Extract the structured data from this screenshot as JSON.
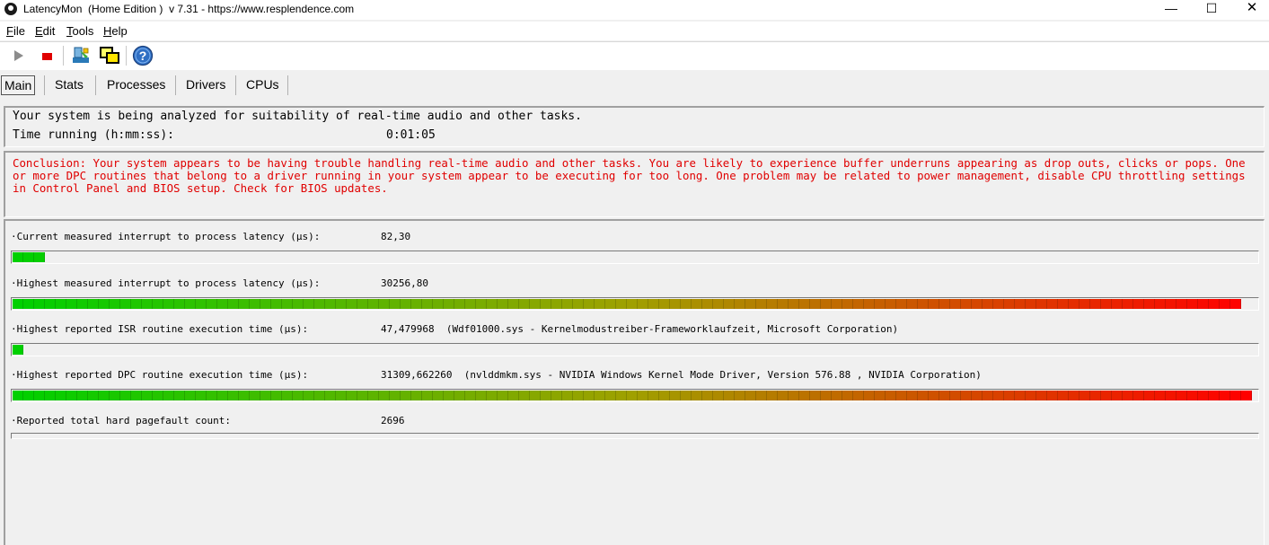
{
  "window": {
    "title": "LatencyMon  (Home Edition )  v 7.31 - https://www.resplendence.com",
    "minimize": "—",
    "maximize": "☐",
    "close": "✕"
  },
  "menu": [
    "File",
    "Edit",
    "Tools",
    "Help"
  ],
  "toolbar": {
    "icons": [
      "play-icon",
      "stop-icon",
      "process-tool-icon",
      "windows-tool-icon",
      "help-icon"
    ]
  },
  "tabs": [
    {
      "label": "Main",
      "active": true
    },
    {
      "label": "Stats",
      "active": false
    },
    {
      "label": "Processes",
      "active": false
    },
    {
      "label": "Drivers",
      "active": false
    },
    {
      "label": "CPUs",
      "active": false
    }
  ],
  "status": {
    "analyzing": "Your system is being analyzed for suitability of real-time audio and other tasks.",
    "time_label": "Time running (h:mm:ss):",
    "time_value": "0:01:05"
  },
  "conclusion": "Conclusion: Your system appears to be having trouble handling real-time audio and other tasks. You are likely to experience buffer underruns appearing as drop outs, clicks or pops. One or more DPC routines that belong to a driver running in your system appear to be executing for too long. One problem may be related to power management, disable CPU throttling settings in Control Panel and BIOS setup. Check for BIOS updates.",
  "metrics": [
    {
      "label": "·Current measured interrupt to process latency (µs):",
      "value": "82,30",
      "detail": "",
      "bar_fraction": 0.027
    },
    {
      "label": "·Highest measured interrupt to process latency (µs):",
      "value": "30256,80",
      "detail": "",
      "bar_fraction": 0.99
    },
    {
      "label": "·Highest reported ISR routine execution time (µs):",
      "value": "47,479968",
      "detail": "(Wdf01000.sys - Kernelmodustreiber-Frameworklaufzeit, Microsoft Corporation)",
      "bar_fraction": 0.016
    },
    {
      "label": "·Highest reported DPC routine execution time (µs):",
      "value": "31309,662260",
      "detail": "(nvlddmkm.sys - NVIDIA Windows Kernel Mode Driver, Version 576.88 , NVIDIA Corporation)",
      "bar_fraction": 1.0
    },
    {
      "label": "·Reported total hard pagefault count:",
      "value": "2696",
      "detail": "",
      "bar_fraction": 0
    }
  ],
  "colors": {
    "bar_start": "#00d000",
    "bar_mid": "#a0a000",
    "bar_end": "#ff0000",
    "conclusion_text": "#e00000"
  }
}
